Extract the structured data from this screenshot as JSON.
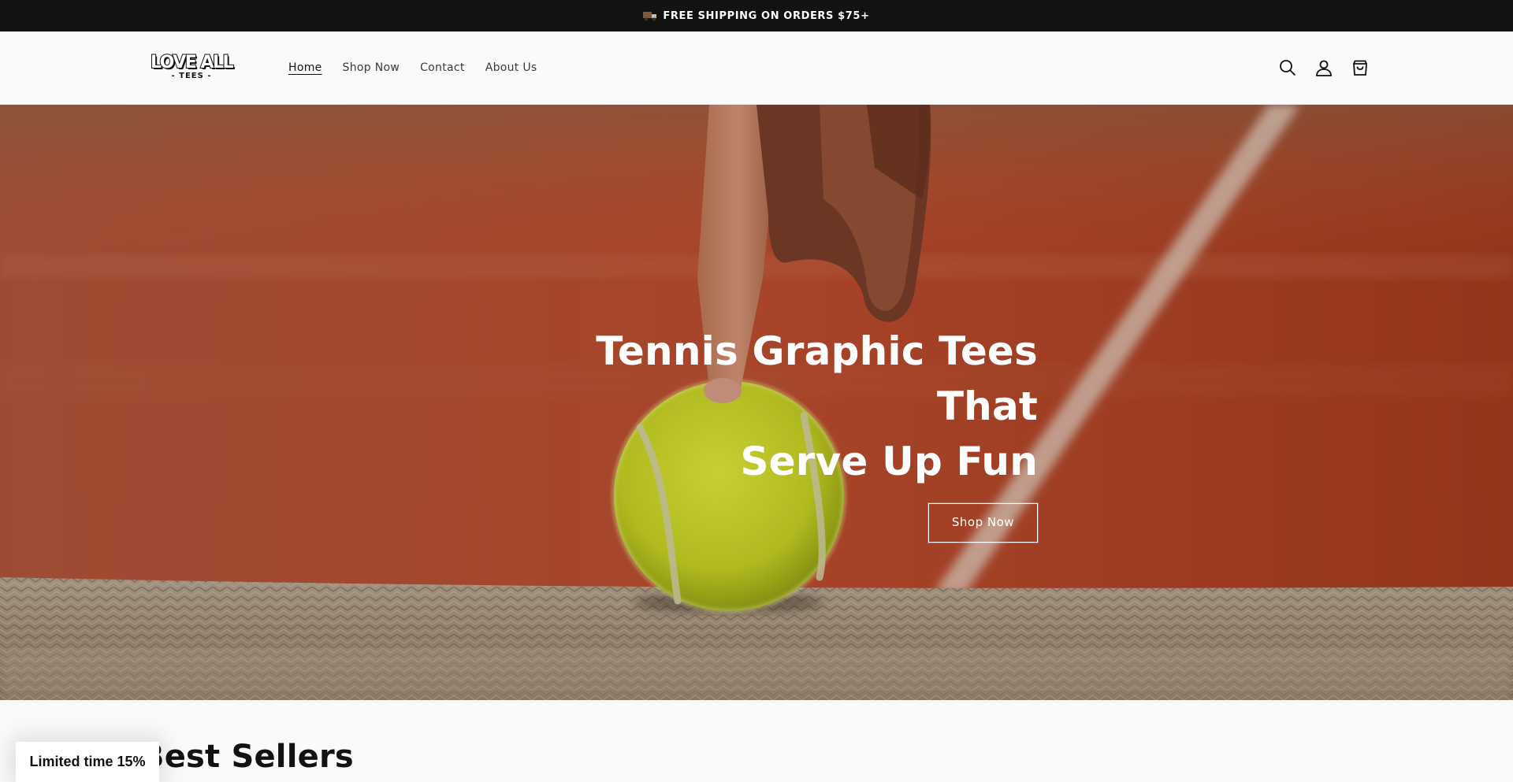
{
  "announcement": {
    "text": "FREE SHIPPING ON ORDERS $75+",
    "icon": "truck-icon"
  },
  "header": {
    "logo": {
      "line1": "LOVE ALL",
      "line2": "- TEES -"
    },
    "nav": [
      {
        "label": "Home",
        "active": true
      },
      {
        "label": "Shop Now",
        "active": false
      },
      {
        "label": "Contact",
        "active": false
      },
      {
        "label": "About Us",
        "active": false
      }
    ],
    "icons": [
      "search-icon",
      "account-icon",
      "cart-icon"
    ]
  },
  "hero": {
    "title_line1": "Tennis Graphic Tees That",
    "title_line2": "Serve Up Fun",
    "button_label": "Shop Now"
  },
  "section": {
    "title": "Best Sellers"
  },
  "promo": {
    "label": "Limited time 15%"
  },
  "colors": {
    "announcement_bg": "#121212",
    "court_clay": "#b5472b",
    "ball_yellow": "#d4e02a",
    "page_bg": "#fafafa"
  }
}
